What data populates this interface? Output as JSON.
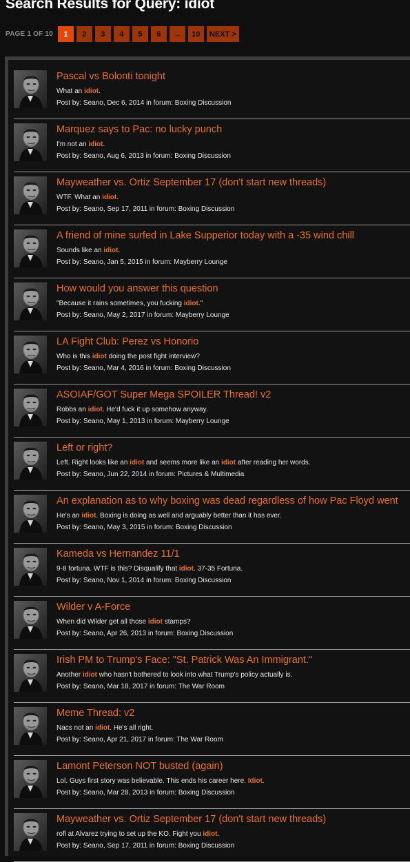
{
  "page_title": "Search Results for Query: idiot",
  "pagination": {
    "label": "PAGE 1 OF 10",
    "buttons": [
      "1",
      "2",
      "3",
      "4",
      "5",
      "6",
      "→",
      "10",
      "NEXT >"
    ],
    "active_index": 0
  },
  "colors": {
    "accent": "#e8702a",
    "pager": "#9c3509",
    "pager_active": "#e0480e"
  },
  "avatar_icon": "user-avatar-icon",
  "results": [
    {
      "title": "Pascal vs Bolonti tonight",
      "snippet": [
        "What an ",
        "idiot",
        "."
      ],
      "meta": "Post by: Seano, Dec 6, 2014 in forum: Boxing Discussion"
    },
    {
      "title": "Marquez says to Pac: no lucky punch",
      "snippet": [
        "I'm not an ",
        "idiot",
        "."
      ],
      "meta": "Post by: Seano, Aug 6, 2013 in forum: Boxing Discussion"
    },
    {
      "title": "Mayweather vs. Ortiz September 17 (don't start new threads)",
      "snippet": [
        "WTF. What an ",
        "idiot",
        "."
      ],
      "meta": "Post by: Seano, Sep 17, 2011 in forum: Boxing Discussion"
    },
    {
      "title": "A friend of mine surfed in Lake Supperior today with a -35 wind chill",
      "snippet": [
        "Sounds like an ",
        "idiot",
        "."
      ],
      "meta": "Post by: Seano, Jan 5, 2015 in forum: Mayberry Lounge"
    },
    {
      "title": "How would you answer this question",
      "snippet": [
        "\"Because it rains sometimes, you fucking ",
        "idiot",
        ".\""
      ],
      "meta": "Post by: Seano, May 2, 2017 in forum: Mayberry Lounge"
    },
    {
      "title": "LA Fight Club: Perez vs Honorio",
      "snippet": [
        "Who is this ",
        "idiot",
        " doing the post fight interview?"
      ],
      "meta": "Post by: Seano, Mar 4, 2016 in forum: Boxing Discussion"
    },
    {
      "title": "ASOIAF/GOT Super Mega SPOILER Thread! v2",
      "snippet": [
        "Robbs an ",
        "idiot",
        ". He'd fuck it up somehow anyway."
      ],
      "meta": "Post by: Seano, May 1, 2013 in forum: Mayberry Lounge"
    },
    {
      "title": "Left or right?",
      "snippet": [
        "Left. Right looks like an ",
        "idiot",
        " and seems more like an ",
        "idiot",
        " after reading her words."
      ],
      "meta": "Post by: Seano, Jun 22, 2014 in forum: Pictures & Multimedia"
    },
    {
      "title": "An explanation as to why boxing was dead regardless of how Pac Floyd went",
      "snippet": [
        "He's an ",
        "idiot",
        ". Boxing is doing as well and arguably better than it has ever."
      ],
      "meta": "Post by: Seano, May 3, 2015 in forum: Boxing Discussion"
    },
    {
      "title": "Kameda vs Hernandez 11/1",
      "snippet": [
        "9-8 fortuna. WTF is this? Disqualify that ",
        "idiot",
        ". 37-35 Fortuna."
      ],
      "meta": "Post by: Seano, Nov 1, 2014 in forum: Boxing Discussion"
    },
    {
      "title": "Wilder v A-Force",
      "snippet": [
        "When did Wilder get all those ",
        "idiot",
        " stamps?"
      ],
      "meta": "Post by: Seano, Apr 26, 2013 in forum: Boxing Discussion"
    },
    {
      "title": "Irish PM to Trump's Face: \"St. Patrick Was An Immigrant.\"",
      "snippet": [
        "Another ",
        "idiot",
        " who hasn't bothered to look into what Trump's policy actually is."
      ],
      "meta": "Post by: Seano, Mar 18, 2017 in forum: The War Room"
    },
    {
      "title": "Meme Thread: v2",
      "snippet": [
        "Nacs not an ",
        "idiot",
        ". He's all right."
      ],
      "meta": "Post by: Seano, Apr 21, 2017 in forum: The War Room"
    },
    {
      "title": "Lamont Peterson NOT busted (again)",
      "snippet": [
        "Lol. Guys first story was believable. This ends his career here. ",
        "Idiot",
        "."
      ],
      "meta": "Post by: Seano, Mar 28, 2013 in forum: Boxing Discussion"
    },
    {
      "title": "Mayweather vs. Ortiz September 17 (don't start new threads)",
      "snippet": [
        "rofl at Alvarez trying to set up the KO. Fight you ",
        "idiot",
        "."
      ],
      "meta": "Post by: Seano, Sep 17, 2011 in forum: Boxing Discussion"
    }
  ]
}
